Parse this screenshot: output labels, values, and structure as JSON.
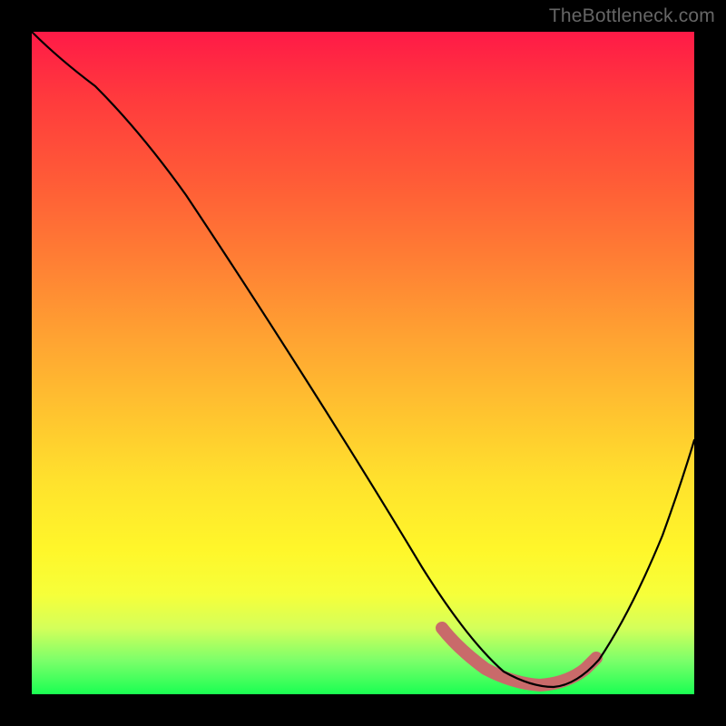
{
  "watermark": "TheBottleneck.com",
  "chart_data": {
    "type": "line",
    "title": "",
    "xlabel": "",
    "ylabel": "",
    "xlim": [
      0,
      100
    ],
    "ylim": [
      0,
      100
    ],
    "grid": false,
    "curve": {
      "description": "Black bottleneck curve descending from upper-left, reaching a flat minimum around x≈70–82, then rising toward upper-right.",
      "x": [
        0,
        6,
        12,
        18,
        24,
        30,
        36,
        42,
        48,
        54,
        60,
        66,
        70,
        74,
        78,
        82,
        86,
        90,
        94,
        100
      ],
      "values": [
        100,
        97,
        93,
        87,
        80,
        71,
        62,
        52,
        42,
        32,
        22,
        12,
        6,
        3,
        2,
        3,
        8,
        18,
        30,
        48
      ]
    },
    "optimal_band": {
      "description": "Thick muted-red segment highlighting the flat minimum region of the curve.",
      "x": [
        62,
        66,
        70,
        74,
        78,
        82,
        85
      ],
      "values": [
        10,
        6,
        3,
        2,
        2,
        3,
        5
      ],
      "color": "#c96a6a"
    },
    "background_gradient": {
      "top_color": "#ff1a47",
      "bottom_color": "#1aff52"
    }
  }
}
